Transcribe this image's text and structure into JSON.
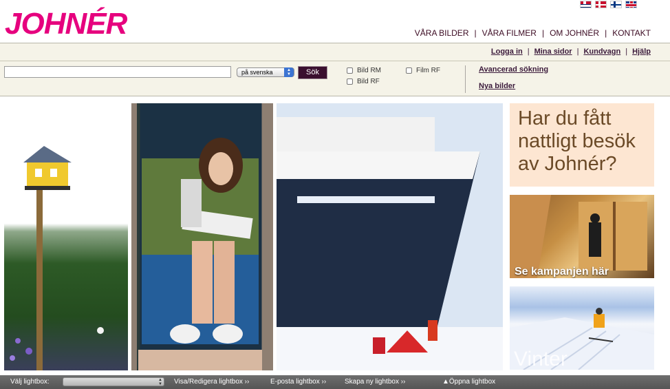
{
  "brand": {
    "logo_text": "JOHNÉR",
    "accent": "#e6007e",
    "dark": "#3a0f2f"
  },
  "flags": [
    "norway-flag-icon",
    "denmark-flag-icon",
    "finland-flag-icon",
    "uk-flag-icon"
  ],
  "main_nav": {
    "items": [
      {
        "label": "VÅRA BILDER"
      },
      {
        "label": "VÅRA FILMER"
      },
      {
        "label": "OM JOHNÉR"
      },
      {
        "label": "KONTAKT"
      }
    ],
    "separator": "|"
  },
  "account_links": {
    "login": "Logga in",
    "my_pages": "Mina sidor",
    "cart": "Kundvagn",
    "help": "Hjälp",
    "separator": "|"
  },
  "search": {
    "value": "",
    "language": "på svenska",
    "button_label": "Sök",
    "filters": [
      {
        "label": "Bild RM",
        "checked": false
      },
      {
        "label": "Film RF",
        "checked": false
      },
      {
        "label": "Bild RF",
        "checked": false
      }
    ],
    "advanced_link": "Avancerad sökning",
    "new_images_link": "Nya bilder"
  },
  "promo": {
    "headline": "Har du fått nattligt besök av Johnér?",
    "campaign_caption": "Se kampanjen här",
    "winter_caption": "Vinter"
  },
  "lightbox_bar": {
    "select_label": "Välj lightbox:",
    "select_value": "",
    "view_edit": "Visa/Redigera lightbox ››",
    "email": "E-posta lightbox ››",
    "create_new": "Skapa ny lightbox ››",
    "open": "▲Öppna lightbox"
  }
}
